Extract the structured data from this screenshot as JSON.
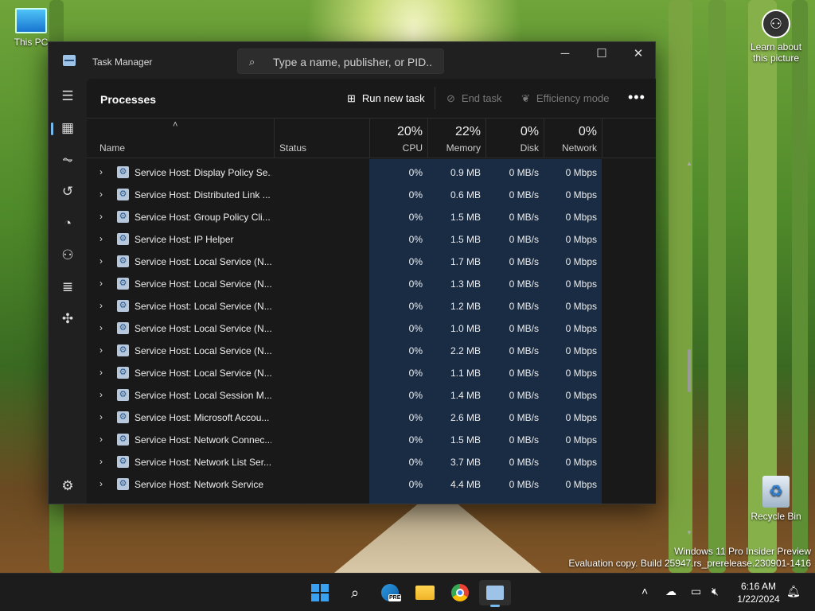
{
  "desktop": {
    "icons": [
      {
        "label": "This PC"
      },
      {
        "label": "Recycle Bin"
      }
    ],
    "learn_about": "Learn about this picture",
    "watermark_line1": "Windows 11 Pro Insider Preview",
    "watermark_line2": "Evaluation copy. Build 25947.rs_prerelease.230901-1416"
  },
  "window": {
    "title": "Task Manager",
    "search_placeholder": "Type a name, publisher, or PID...",
    "page_title": "Processes",
    "commands": {
      "run_new_task": "Run new task",
      "end_task": "End task",
      "efficiency_mode": "Efficiency mode",
      "more": "•••"
    },
    "columns": {
      "name": "Name",
      "status": "Status",
      "cpu": {
        "pct": "20%",
        "label": "CPU"
      },
      "memory": {
        "pct": "22%",
        "label": "Memory"
      },
      "disk": {
        "pct": "0%",
        "label": "Disk"
      },
      "network": {
        "pct": "0%",
        "label": "Network"
      }
    },
    "rows": [
      {
        "name": "Service Host: Display Policy Se...",
        "cpu": "0%",
        "memory": "0.9 MB",
        "disk": "0 MB/s",
        "network": "0 Mbps"
      },
      {
        "name": "Service Host: Distributed Link ...",
        "cpu": "0%",
        "memory": "0.6 MB",
        "disk": "0 MB/s",
        "network": "0 Mbps"
      },
      {
        "name": "Service Host: Group Policy Cli...",
        "cpu": "0%",
        "memory": "1.5 MB",
        "disk": "0 MB/s",
        "network": "0 Mbps"
      },
      {
        "name": "Service Host: IP Helper",
        "cpu": "0%",
        "memory": "1.5 MB",
        "disk": "0 MB/s",
        "network": "0 Mbps"
      },
      {
        "name": "Service Host: Local Service (N...",
        "cpu": "0%",
        "memory": "1.7 MB",
        "disk": "0 MB/s",
        "network": "0 Mbps"
      },
      {
        "name": "Service Host: Local Service (N...",
        "cpu": "0%",
        "memory": "1.3 MB",
        "disk": "0 MB/s",
        "network": "0 Mbps"
      },
      {
        "name": "Service Host: Local Service (N...",
        "cpu": "0%",
        "memory": "1.2 MB",
        "disk": "0 MB/s",
        "network": "0 Mbps"
      },
      {
        "name": "Service Host: Local Service (N...",
        "cpu": "0%",
        "memory": "1.0 MB",
        "disk": "0 MB/s",
        "network": "0 Mbps"
      },
      {
        "name": "Service Host: Local Service (N...",
        "cpu": "0%",
        "memory": "2.2 MB",
        "disk": "0 MB/s",
        "network": "0 Mbps"
      },
      {
        "name": "Service Host: Local Service (N...",
        "cpu": "0%",
        "memory": "1.1 MB",
        "disk": "0 MB/s",
        "network": "0 Mbps"
      },
      {
        "name": "Service Host: Local Session M...",
        "cpu": "0%",
        "memory": "1.4 MB",
        "disk": "0 MB/s",
        "network": "0 Mbps"
      },
      {
        "name": "Service Host: Microsoft Accou...",
        "cpu": "0%",
        "memory": "2.6 MB",
        "disk": "0 MB/s",
        "network": "0 Mbps"
      },
      {
        "name": "Service Host: Network Connec...",
        "cpu": "0%",
        "memory": "1.5 MB",
        "disk": "0 MB/s",
        "network": "0 Mbps"
      },
      {
        "name": "Service Host: Network List Ser...",
        "cpu": "0%",
        "memory": "3.7 MB",
        "disk": "0 MB/s",
        "network": "0 Mbps"
      },
      {
        "name": "Service Host: Network Service",
        "cpu": "0%",
        "memory": "4.4 MB",
        "disk": "0 MB/s",
        "network": "0 Mbps"
      }
    ]
  },
  "taskbar": {
    "time": "6:16 AM",
    "date": "1/22/2024",
    "edge_badge": "PRE"
  },
  "colors": {
    "accent": "#76b9ed",
    "selection_shade": "#1a2c44",
    "window_bg": "#202020"
  }
}
